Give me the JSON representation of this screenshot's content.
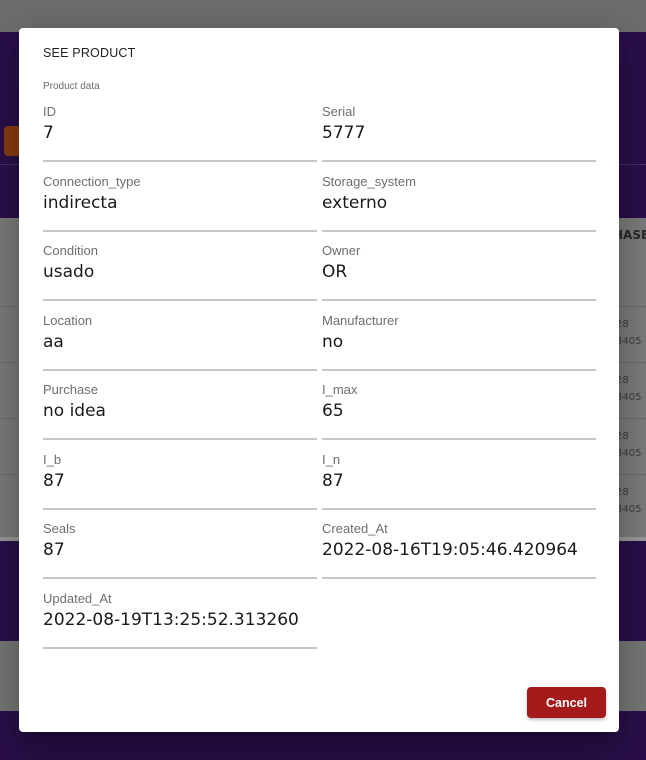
{
  "background": {
    "column_header": "HASE",
    "rows": [
      {
        "line1": "28",
        "line2": "3405"
      },
      {
        "line1": "28",
        "line2": "3405"
      },
      {
        "line1": "28",
        "line2": "3405"
      },
      {
        "line1": "28",
        "line2": "3405"
      }
    ]
  },
  "dialog": {
    "title": "SEE PRODUCT",
    "section_label": "Product data",
    "fields": {
      "id": {
        "label": "ID",
        "value": "7"
      },
      "serial": {
        "label": "Serial",
        "value": "5777"
      },
      "connection_type": {
        "label": "Connection_type",
        "value": "indirecta"
      },
      "storage_system": {
        "label": "Storage_system",
        "value": "externo"
      },
      "condition": {
        "label": "Condition",
        "value": "usado"
      },
      "owner": {
        "label": "Owner",
        "value": "OR"
      },
      "location": {
        "label": "Location",
        "value": "aa"
      },
      "manufacturer": {
        "label": "Manufacturer",
        "value": "no"
      },
      "purchase": {
        "label": "Purchase",
        "value": "no idea"
      },
      "i_max": {
        "label": "I_max",
        "value": "65"
      },
      "i_b": {
        "label": "I_b",
        "value": "87"
      },
      "i_n": {
        "label": "I_n",
        "value": "87"
      },
      "seals": {
        "label": "Seals",
        "value": "87"
      },
      "created_at": {
        "label": "Created_At",
        "value": "2022-08-16T19:05:46.420964"
      },
      "updated_at": {
        "label": "Updated_At",
        "value": "2022-08-19T13:25:52.313260"
      }
    },
    "cancel_label": "Cancel"
  },
  "colors": {
    "cancel_button": "#a51b1b",
    "app_header": "#2a0f4a"
  }
}
